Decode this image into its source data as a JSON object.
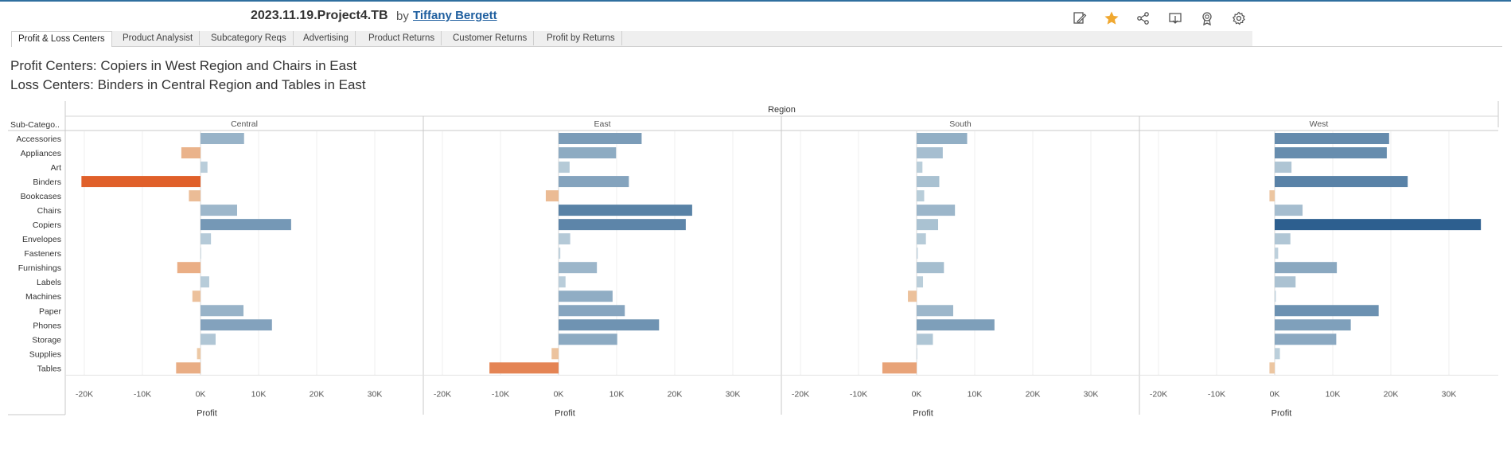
{
  "workbook": {
    "title": "2023.11.19.Project4.TB",
    "by_label": "by",
    "author": "Tiffany Bergett"
  },
  "toolbar": [
    {
      "name": "edit-icon"
    },
    {
      "name": "favorite-star-icon"
    },
    {
      "name": "share-icon"
    },
    {
      "name": "download-icon"
    },
    {
      "name": "badge-icon"
    },
    {
      "name": "settings-gear-icon"
    }
  ],
  "tabs": [
    {
      "label": "Profit & Loss Centers",
      "active": true
    },
    {
      "label": "Product Analysist",
      "active": false
    },
    {
      "label": "Subcategory Reqs",
      "active": false
    },
    {
      "label": "Advertising",
      "active": false
    },
    {
      "label": "Product Returns",
      "active": false
    },
    {
      "label": "Customer Returns",
      "active": false
    },
    {
      "label": "Profit by Returns",
      "active": false
    }
  ],
  "dashboard": {
    "title_line1": "Profit Centers: Copiers in West Region and Chairs in East",
    "title_line2": "Loss Centers: Binders in Central Region and Tables in East"
  },
  "colors": {
    "accent_star": "#f0a830",
    "author_link": "#1f5f9f",
    "positive_scale": [
      "#c3d5df",
      "#2d5f8f"
    ],
    "negative_scale": [
      "#eed3b0",
      "#e0602a"
    ]
  },
  "chart_data": {
    "type": "bar",
    "orientation": "horizontal",
    "column_header": "Region",
    "row_header": "Sub-Catego..",
    "xlabel": "Profit",
    "xlim": [
      -22000,
      37000
    ],
    "xticks": [
      "-20K",
      "-10K",
      "0K",
      "10K",
      "20K",
      "30K"
    ],
    "xtick_values": [
      -20000,
      -10000,
      0,
      10000,
      20000,
      30000
    ],
    "grid": true,
    "categories": [
      "Accessories",
      "Appliances",
      "Art",
      "Binders",
      "Bookcases",
      "Chairs",
      "Copiers",
      "Envelopes",
      "Fasteners",
      "Furnishings",
      "Labels",
      "Machines",
      "Paper",
      "Phones",
      "Storage",
      "Supplies",
      "Tables"
    ],
    "series": [
      {
        "name": "Central",
        "values": [
          7500,
          -3300,
          1200,
          -20500,
          -2000,
          6300,
          15600,
          1800,
          100,
          -4000,
          1500,
          -1400,
          7400,
          12300,
          2600,
          -600,
          -4200
        ]
      },
      {
        "name": "East",
        "values": [
          14300,
          9900,
          1900,
          12100,
          -2200,
          23000,
          21900,
          2000,
          300,
          6600,
          1200,
          9300,
          11400,
          17300,
          10100,
          -1200,
          -11900
        ]
      },
      {
        "name": "South",
        "values": [
          8700,
          4500,
          1000,
          3900,
          1300,
          6600,
          3700,
          1600,
          200,
          4700,
          1100,
          -1500,
          6300,
          13400,
          2800,
          0,
          -5900
        ]
      },
      {
        "name": "West",
        "values": [
          19700,
          19300,
          2900,
          22900,
          -900,
          4800,
          35500,
          2700,
          600,
          10700,
          3600,
          200,
          17900,
          13100,
          10600,
          900,
          -900
        ]
      }
    ]
  }
}
